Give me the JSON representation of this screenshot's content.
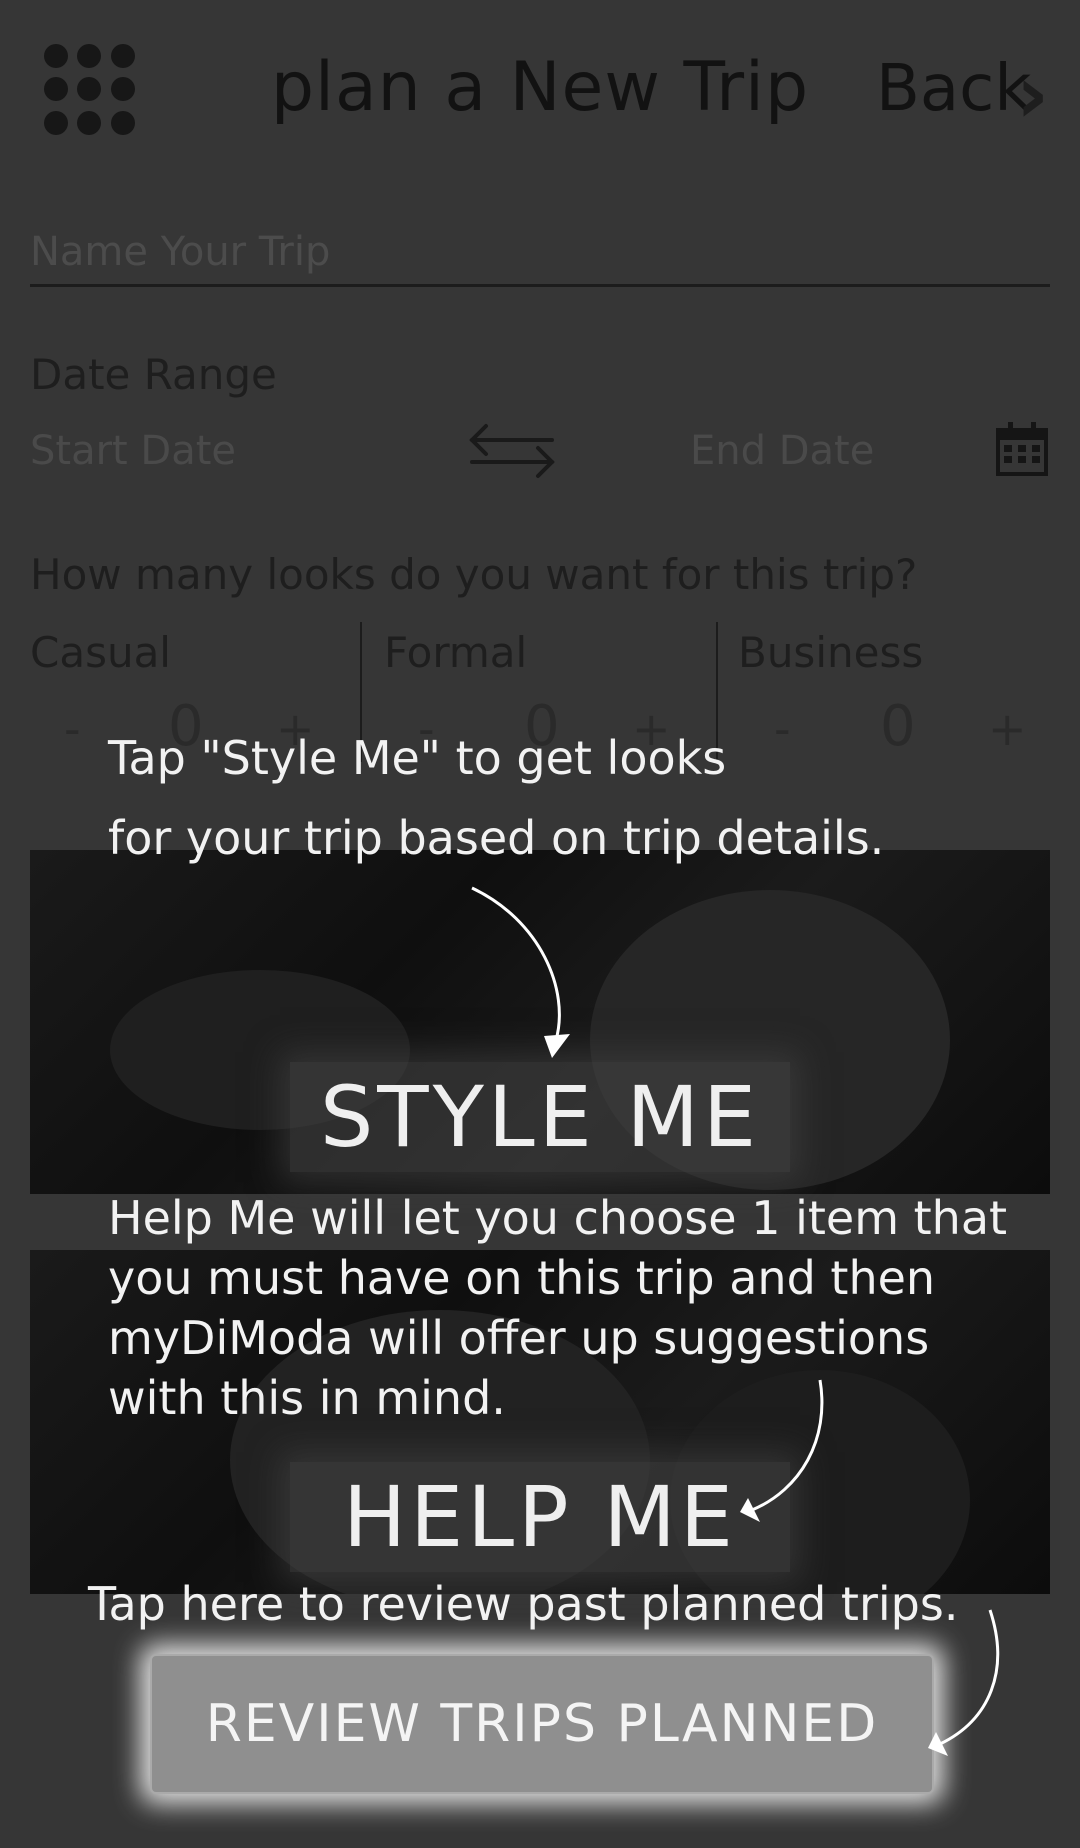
{
  "header": {
    "title": "plan a New Trip",
    "back_label": "Back"
  },
  "trip_name": {
    "placeholder": "Name Your Trip"
  },
  "date_range": {
    "label": "Date Range",
    "start_placeholder": "Start Date",
    "end_placeholder": "End Date"
  },
  "looks": {
    "question": "How many looks do you want for this trip?",
    "categories": [
      {
        "label": "Casual",
        "minus": "-",
        "value": "0",
        "plus": "+"
      },
      {
        "label": "Formal",
        "minus": "-",
        "value": "0",
        "plus": "+"
      },
      {
        "label": "Business",
        "minus": "-",
        "value": "0",
        "plus": "+"
      }
    ]
  },
  "buttons": {
    "style_me": "STYLE ME",
    "help_me": "HELP ME",
    "review_trips": "REVIEW TRIPS PLANNED"
  },
  "tutorial": {
    "tip_style_me": [
      "Tap \"Style Me\" to get looks",
      "for your trip based on trip details."
    ],
    "tip_help_me": [
      "Help Me will let you choose 1 item that",
      "you must have on this trip and then",
      "myDiModa will offer up suggestions",
      "with this in mind."
    ],
    "tip_review": "Tap here to review past planned trips."
  }
}
